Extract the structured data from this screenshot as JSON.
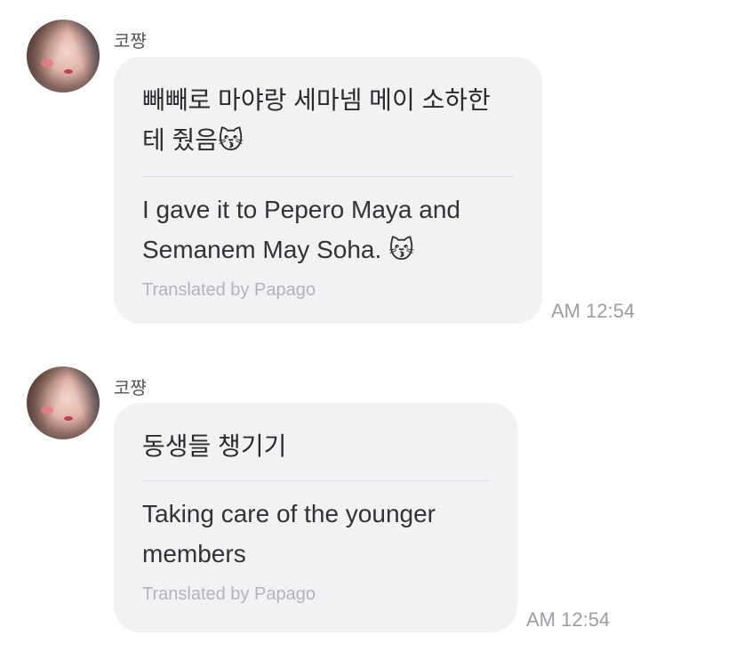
{
  "messages": [
    {
      "sender_name": "코쨩",
      "original_text": "빼빼로 마야랑 세마넴 메이 소하한\n테 줬음😽",
      "translated_text": "I gave it to Pepero Maya and\nSemanem May Soha. 😽",
      "translation_credit": "Translated by Papago",
      "time": "AM 12:54"
    },
    {
      "sender_name": "코쨩",
      "original_text": "동생들 챙기기",
      "translated_text": "Taking care of the younger\nmembers",
      "translation_credit": "Translated by Papago",
      "time": "AM 12:54"
    }
  ]
}
